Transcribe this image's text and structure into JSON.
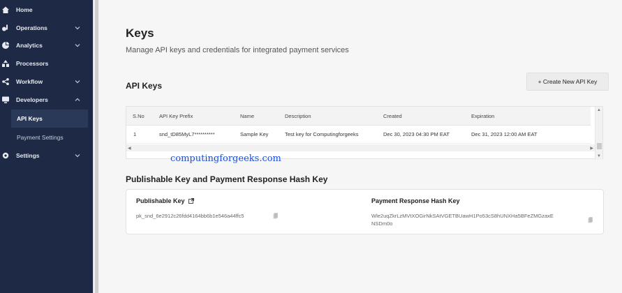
{
  "sidebar": {
    "items": [
      {
        "label": "Home",
        "icon": "home-icon"
      },
      {
        "label": "Operations",
        "icon": "operations-icon"
      },
      {
        "label": "Analytics",
        "icon": "analytics-icon"
      },
      {
        "label": "Processors",
        "icon": "processors-icon"
      },
      {
        "label": "Workflow",
        "icon": "workflow-icon"
      },
      {
        "label": "Developers",
        "icon": "developers-icon"
      },
      {
        "label": "Settings",
        "icon": "settings-icon"
      }
    ],
    "sub_items": [
      {
        "label": "API Keys",
        "active": true
      },
      {
        "label": "Payment Settings",
        "active": false
      }
    ]
  },
  "page": {
    "title": "Keys",
    "subtitle": "Manage API keys and credentials for integrated payment services"
  },
  "api_keys": {
    "title": "API Keys",
    "create_button": "+ Create New API Key",
    "columns": [
      "S.No",
      "API Key Prefix",
      "Name",
      "Description",
      "Created",
      "Expiration"
    ],
    "rows": [
      [
        "1",
        "snd_tD85MyL7**********",
        "Sample Key",
        "Test key for Computingforgeeks",
        "Dec 30, 2023 04:30 PM EAT",
        "Dec 31, 2023 12:00 AM EAT"
      ]
    ]
  },
  "watermark": "computingforgeeks.com",
  "hash_section": {
    "title": "Publishable Key and Payment Response Hash Key",
    "publishable_label": "Publishable Key",
    "publishable_value": "pk_snd_6e2912c26fdd4164bb6b1e546a44ffc5",
    "hash_label": "Payment Response Hash Key",
    "hash_value_line1": "Wle2uqZkrLzMVtXOGirNkSAtVGETBUawH1Po53cS8hUNXHa5BFeZMGzaxE",
    "hash_value_line2": "NSDm0o"
  },
  "colors": {
    "sidebar_bg": "#1e2a45",
    "page_bg": "#f6f6f6",
    "watermark": "#1b4fd6"
  }
}
